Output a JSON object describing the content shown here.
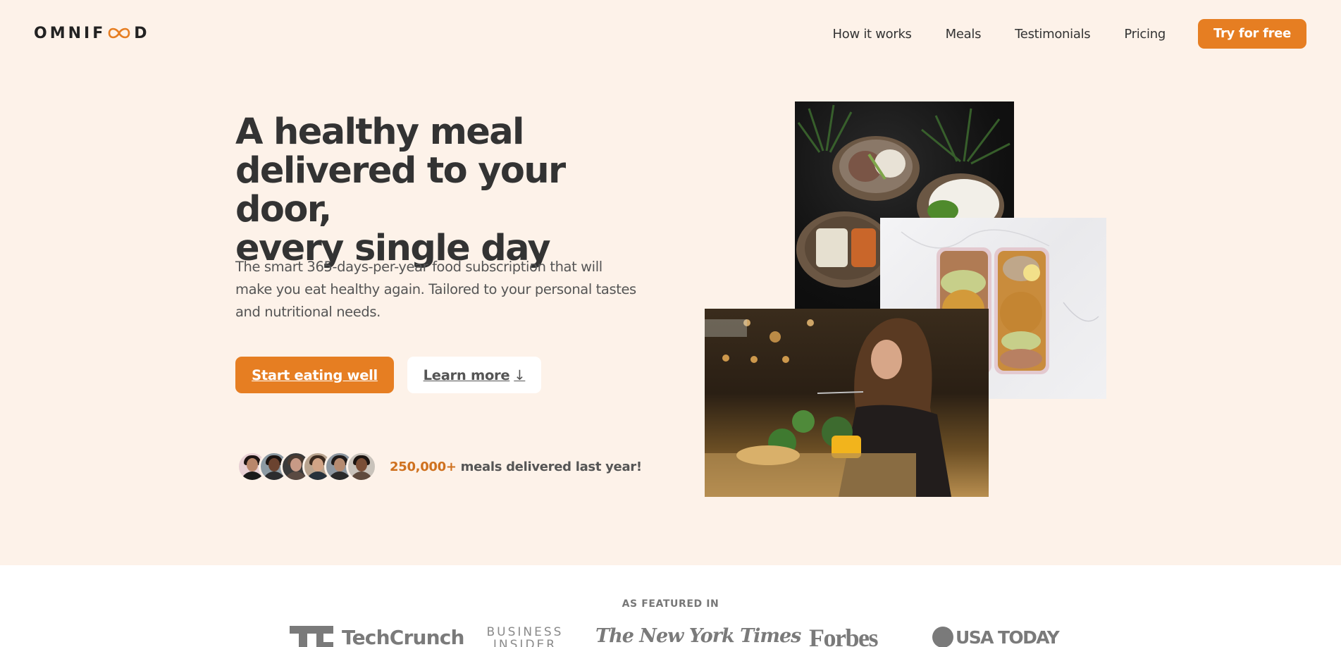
{
  "header": {
    "logo_text_before": "OMNIF",
    "logo_text_after": "D",
    "logo_icon": "infinity-icon",
    "nav": [
      {
        "label": "How it works"
      },
      {
        "label": "Meals"
      },
      {
        "label": "Testimonials"
      },
      {
        "label": "Pricing"
      }
    ],
    "cta_label": "Try for free"
  },
  "hero": {
    "title_lines": [
      "A healthy meal",
      "delivered to your door,",
      "every single day"
    ],
    "description": "The smart 365-days-per-year food subscription that will make you eat healthy again. Tailored to your personal tastes and nutritional needs.",
    "primary_button": "Start eating well",
    "secondary_button": "Learn more",
    "secondary_icon": "↓",
    "delivered_count": "250,000+",
    "delivered_text": " meals delivered last year!",
    "avatars": [
      {
        "name": "customer-1"
      },
      {
        "name": "customer-2"
      },
      {
        "name": "customer-3"
      },
      {
        "name": "customer-4"
      },
      {
        "name": "customer-5"
      },
      {
        "name": "customer-6"
      }
    ],
    "images": [
      {
        "alt": "Bowls of healthy meals on a dark table"
      },
      {
        "alt": "Meal prep boxes with chickpeas and avatocado"
      },
      {
        "alt": "Woman enjoying a meal in a cafe"
      }
    ]
  },
  "featured": {
    "label": "AS FEATURED IN",
    "publications": [
      "TechCrunch",
      "BUSINESS INSIDER",
      "The New York Times",
      "Forbes",
      "USA TODAY"
    ]
  },
  "colors": {
    "accent": "#e67e22",
    "hero_background": "#fdf2e9",
    "text_dark": "#333333",
    "text_muted": "#555555",
    "logo_gray": "#7a7a7a"
  }
}
